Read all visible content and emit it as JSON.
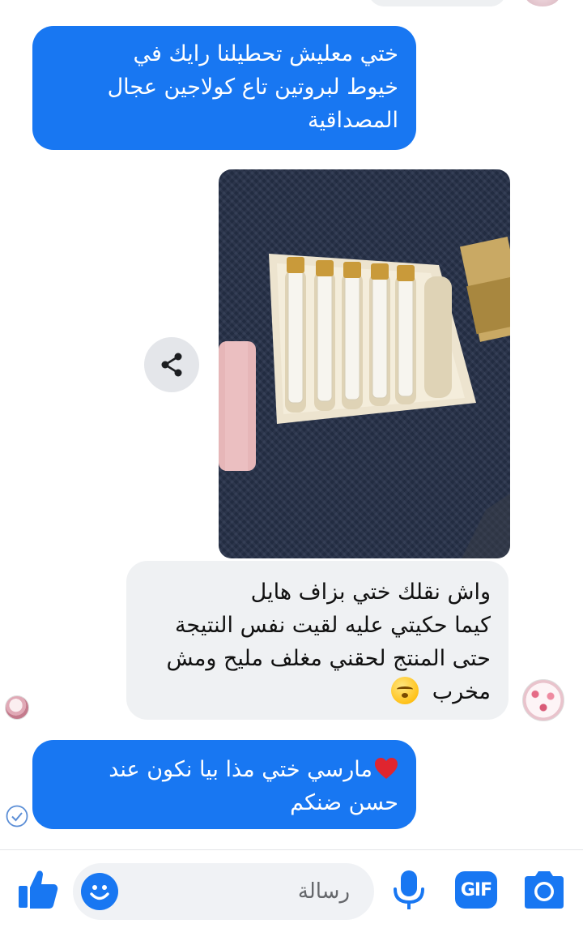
{
  "colors": {
    "accent": "#1877f2",
    "incoming_bubble": "#eff1f3",
    "outgoing_text": "#ffffff"
  },
  "messages": [
    {
      "direction": "outgoing",
      "lines": [
        "ختي معليش تحطيلنا رايك في",
        "خيوط لبروتين تاع كولاجين عجال",
        "المصداقية"
      ]
    },
    {
      "direction": "incoming",
      "type": "photo",
      "photo_description": "gold-capped vials in a cream tray on a navy knit surface",
      "share_icon": "share-icon"
    },
    {
      "direction": "incoming",
      "lines": [
        "واش نقلك ختي بزاف هايل",
        "كيما حكيتي عليه لقيت نفس النتيجة",
        "حتى المنتج لحقني مغلف مليح ومش",
        "مخرب"
      ],
      "trailing_emoji": "kissing-face-emoji"
    },
    {
      "direction": "outgoing",
      "leading_emoji": "red-heart-emoji",
      "lines": [
        "مارسي ختي مذا بيا نكون عند",
        "حسن ضنكم"
      ]
    }
  ],
  "compose": {
    "placeholder": "رسالة",
    "icons": [
      "like-icon",
      "emoji-icon",
      "microphone-icon",
      "gif-icon",
      "camera-icon"
    ],
    "gif_label": "GIF"
  }
}
